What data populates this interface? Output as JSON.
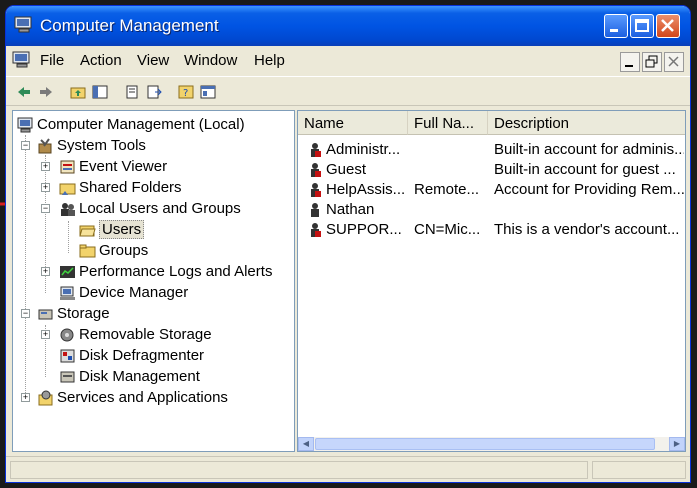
{
  "window": {
    "title": "Computer Management"
  },
  "menu": [
    "File",
    "Action",
    "View",
    "Window",
    "Help"
  ],
  "toolbar_icons": [
    "back-icon",
    "forward-icon",
    "up-folder-icon",
    "show-tree-icon",
    "properties-icon",
    "export-icon",
    "help-icon",
    "console-icon"
  ],
  "tree": [
    {
      "label": "Computer Management (Local)"
    },
    {
      "label": "System Tools"
    },
    {
      "label": "Event Viewer"
    },
    {
      "label": "Shared Folders"
    },
    {
      "label": "Local Users and Groups"
    },
    {
      "label": "Users"
    },
    {
      "label": "Groups"
    },
    {
      "label": "Performance Logs and Alerts"
    },
    {
      "label": "Device Manager"
    },
    {
      "label": "Storage"
    },
    {
      "label": "Removable Storage"
    },
    {
      "label": "Disk Defragmenter"
    },
    {
      "label": "Disk Management"
    },
    {
      "label": "Services and Applications"
    }
  ],
  "list": {
    "columns": [
      "Name",
      "Full Na...",
      "Description"
    ],
    "rows": [
      {
        "name": "Administr...",
        "full_name": "",
        "description": "Built-in account for adminis..."
      },
      {
        "name": "Guest",
        "full_name": "",
        "description": "Built-in account for guest ..."
      },
      {
        "name": "HelpAssis...",
        "full_name": "Remote...",
        "description": "Account for Providing Rem..."
      },
      {
        "name": "Nathan",
        "full_name": "",
        "description": ""
      },
      {
        "name": "SUPPOR...",
        "full_name": "CN=Mic...",
        "description": "This is a vendor's account..."
      }
    ]
  },
  "colors": {
    "titlebar": "#0054e3",
    "annotation_arrow": "#d62020",
    "user_icon_red": "#c41212"
  }
}
